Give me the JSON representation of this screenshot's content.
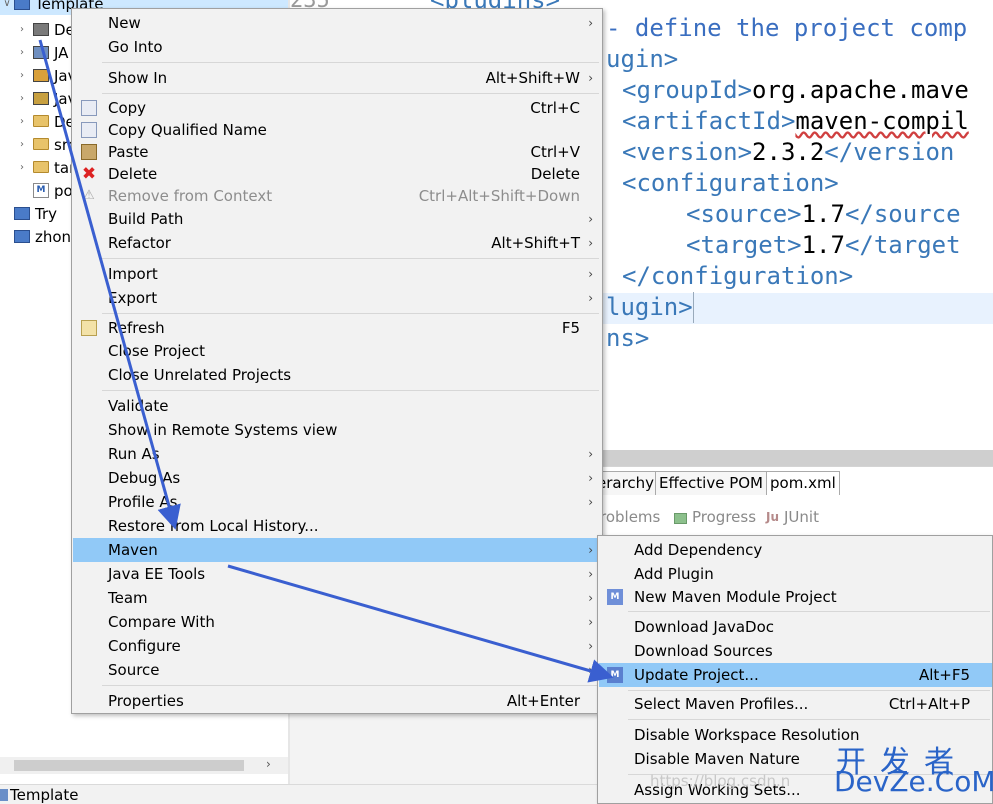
{
  "explorer": {
    "rows": [
      {
        "label": "Template"
      },
      {
        "label": "De"
      },
      {
        "label": "JA"
      },
      {
        "label": "Jav"
      },
      {
        "label": "Jav"
      },
      {
        "label": "De"
      },
      {
        "label": "src"
      },
      {
        "label": "tar"
      },
      {
        "label": "po"
      },
      {
        "label": "Try"
      },
      {
        "label": "zhon"
      }
    ]
  },
  "statusbar": {
    "text": "Template"
  },
  "editor": {
    "line_number": "235°",
    "lines": [
      {
        "text": "<plugins>"
      },
      {
        "text": "- define the project comp"
      },
      {
        "text": "ugin>"
      },
      {
        "text": "<groupId>",
        "value": "org.apache.mave"
      },
      {
        "text": "<artifactId>",
        "value": "maven-compil"
      },
      {
        "text": "<version>",
        "value": "2.3.2",
        "close": "</version"
      },
      {
        "text": "<configuration>"
      },
      {
        "text": "<source>",
        "value": "1.7",
        "close": "</source"
      },
      {
        "text": "<target>",
        "value": "1.7",
        "close": "</target"
      },
      {
        "text": "</configuration>"
      },
      {
        "text": "lugin>"
      },
      {
        "text": "ns>"
      }
    ]
  },
  "pom_tabs": [
    {
      "label": "erarchy"
    },
    {
      "label": "Effective POM"
    },
    {
      "label": "pom.xml"
    }
  ],
  "views": [
    {
      "label": "roblems"
    },
    {
      "label": "Progress"
    },
    {
      "label": "JUnit"
    }
  ],
  "context_menu": {
    "items": [
      {
        "label": "New",
        "shortcut": "",
        "submenu": true
      },
      {
        "label": "Go Into",
        "shortcut": "",
        "submenu": false
      },
      {
        "label": "Show In",
        "shortcut": "Alt+Shift+W",
        "submenu": true
      },
      {
        "label": "Copy",
        "shortcut": "Ctrl+C",
        "submenu": false
      },
      {
        "label": "Copy Qualified Name",
        "shortcut": "",
        "submenu": false
      },
      {
        "label": "Paste",
        "shortcut": "Ctrl+V",
        "submenu": false
      },
      {
        "label": "Delete",
        "shortcut": "Delete",
        "submenu": false
      },
      {
        "label": "Remove from Context",
        "shortcut": "Ctrl+Alt+Shift+Down",
        "submenu": false,
        "disabled": true
      },
      {
        "label": "Build Path",
        "shortcut": "",
        "submenu": true
      },
      {
        "label": "Refactor",
        "shortcut": "Alt+Shift+T",
        "submenu": true
      },
      {
        "label": "Import",
        "shortcut": "",
        "submenu": true
      },
      {
        "label": "Export",
        "shortcut": "",
        "submenu": true
      },
      {
        "label": "Refresh",
        "shortcut": "F5",
        "submenu": false
      },
      {
        "label": "Close Project",
        "shortcut": "",
        "submenu": false
      },
      {
        "label": "Close Unrelated Projects",
        "shortcut": "",
        "submenu": false
      },
      {
        "label": "Validate",
        "shortcut": "",
        "submenu": false
      },
      {
        "label": "Show in Remote Systems view",
        "shortcut": "",
        "submenu": false
      },
      {
        "label": "Run As",
        "shortcut": "",
        "submenu": true
      },
      {
        "label": "Debug As",
        "shortcut": "",
        "submenu": true
      },
      {
        "label": "Profile As",
        "shortcut": "",
        "submenu": true
      },
      {
        "label": "Restore from Local History...",
        "shortcut": "",
        "submenu": false
      },
      {
        "label": "Maven",
        "shortcut": "",
        "submenu": true,
        "highlighted": true
      },
      {
        "label": "Java EE Tools",
        "shortcut": "",
        "submenu": true
      },
      {
        "label": "Team",
        "shortcut": "",
        "submenu": true
      },
      {
        "label": "Compare With",
        "shortcut": "",
        "submenu": true
      },
      {
        "label": "Configure",
        "shortcut": "",
        "submenu": true
      },
      {
        "label": "Source",
        "shortcut": "",
        "submenu": true
      },
      {
        "label": "Properties",
        "shortcut": "Alt+Enter",
        "submenu": false
      }
    ]
  },
  "maven_submenu": {
    "items": [
      {
        "label": "Add Dependency",
        "shortcut": ""
      },
      {
        "label": "Add Plugin",
        "shortcut": ""
      },
      {
        "label": "New Maven Module Project",
        "shortcut": ""
      },
      {
        "label": "Download JavaDoc",
        "shortcut": ""
      },
      {
        "label": "Download Sources",
        "shortcut": ""
      },
      {
        "label": "Update Project...",
        "shortcut": "Alt+F5",
        "highlighted": true
      },
      {
        "label": "Select Maven Profiles...",
        "shortcut": "Ctrl+Alt+P"
      },
      {
        "label": "Disable Workspace Resolution",
        "shortcut": ""
      },
      {
        "label": "Disable Maven Nature",
        "shortcut": ""
      },
      {
        "label": "Assign Working Sets...",
        "shortcut": ""
      }
    ]
  },
  "watermark": {
    "line1": "开发者",
    "line2": "DevZe.CoM",
    "url": "https://blog.csdn.n"
  },
  "colors": {
    "menu_highlight": "#91c9f7",
    "arrow": "#3a5fd0",
    "xml_tag": "#3a78b8"
  }
}
